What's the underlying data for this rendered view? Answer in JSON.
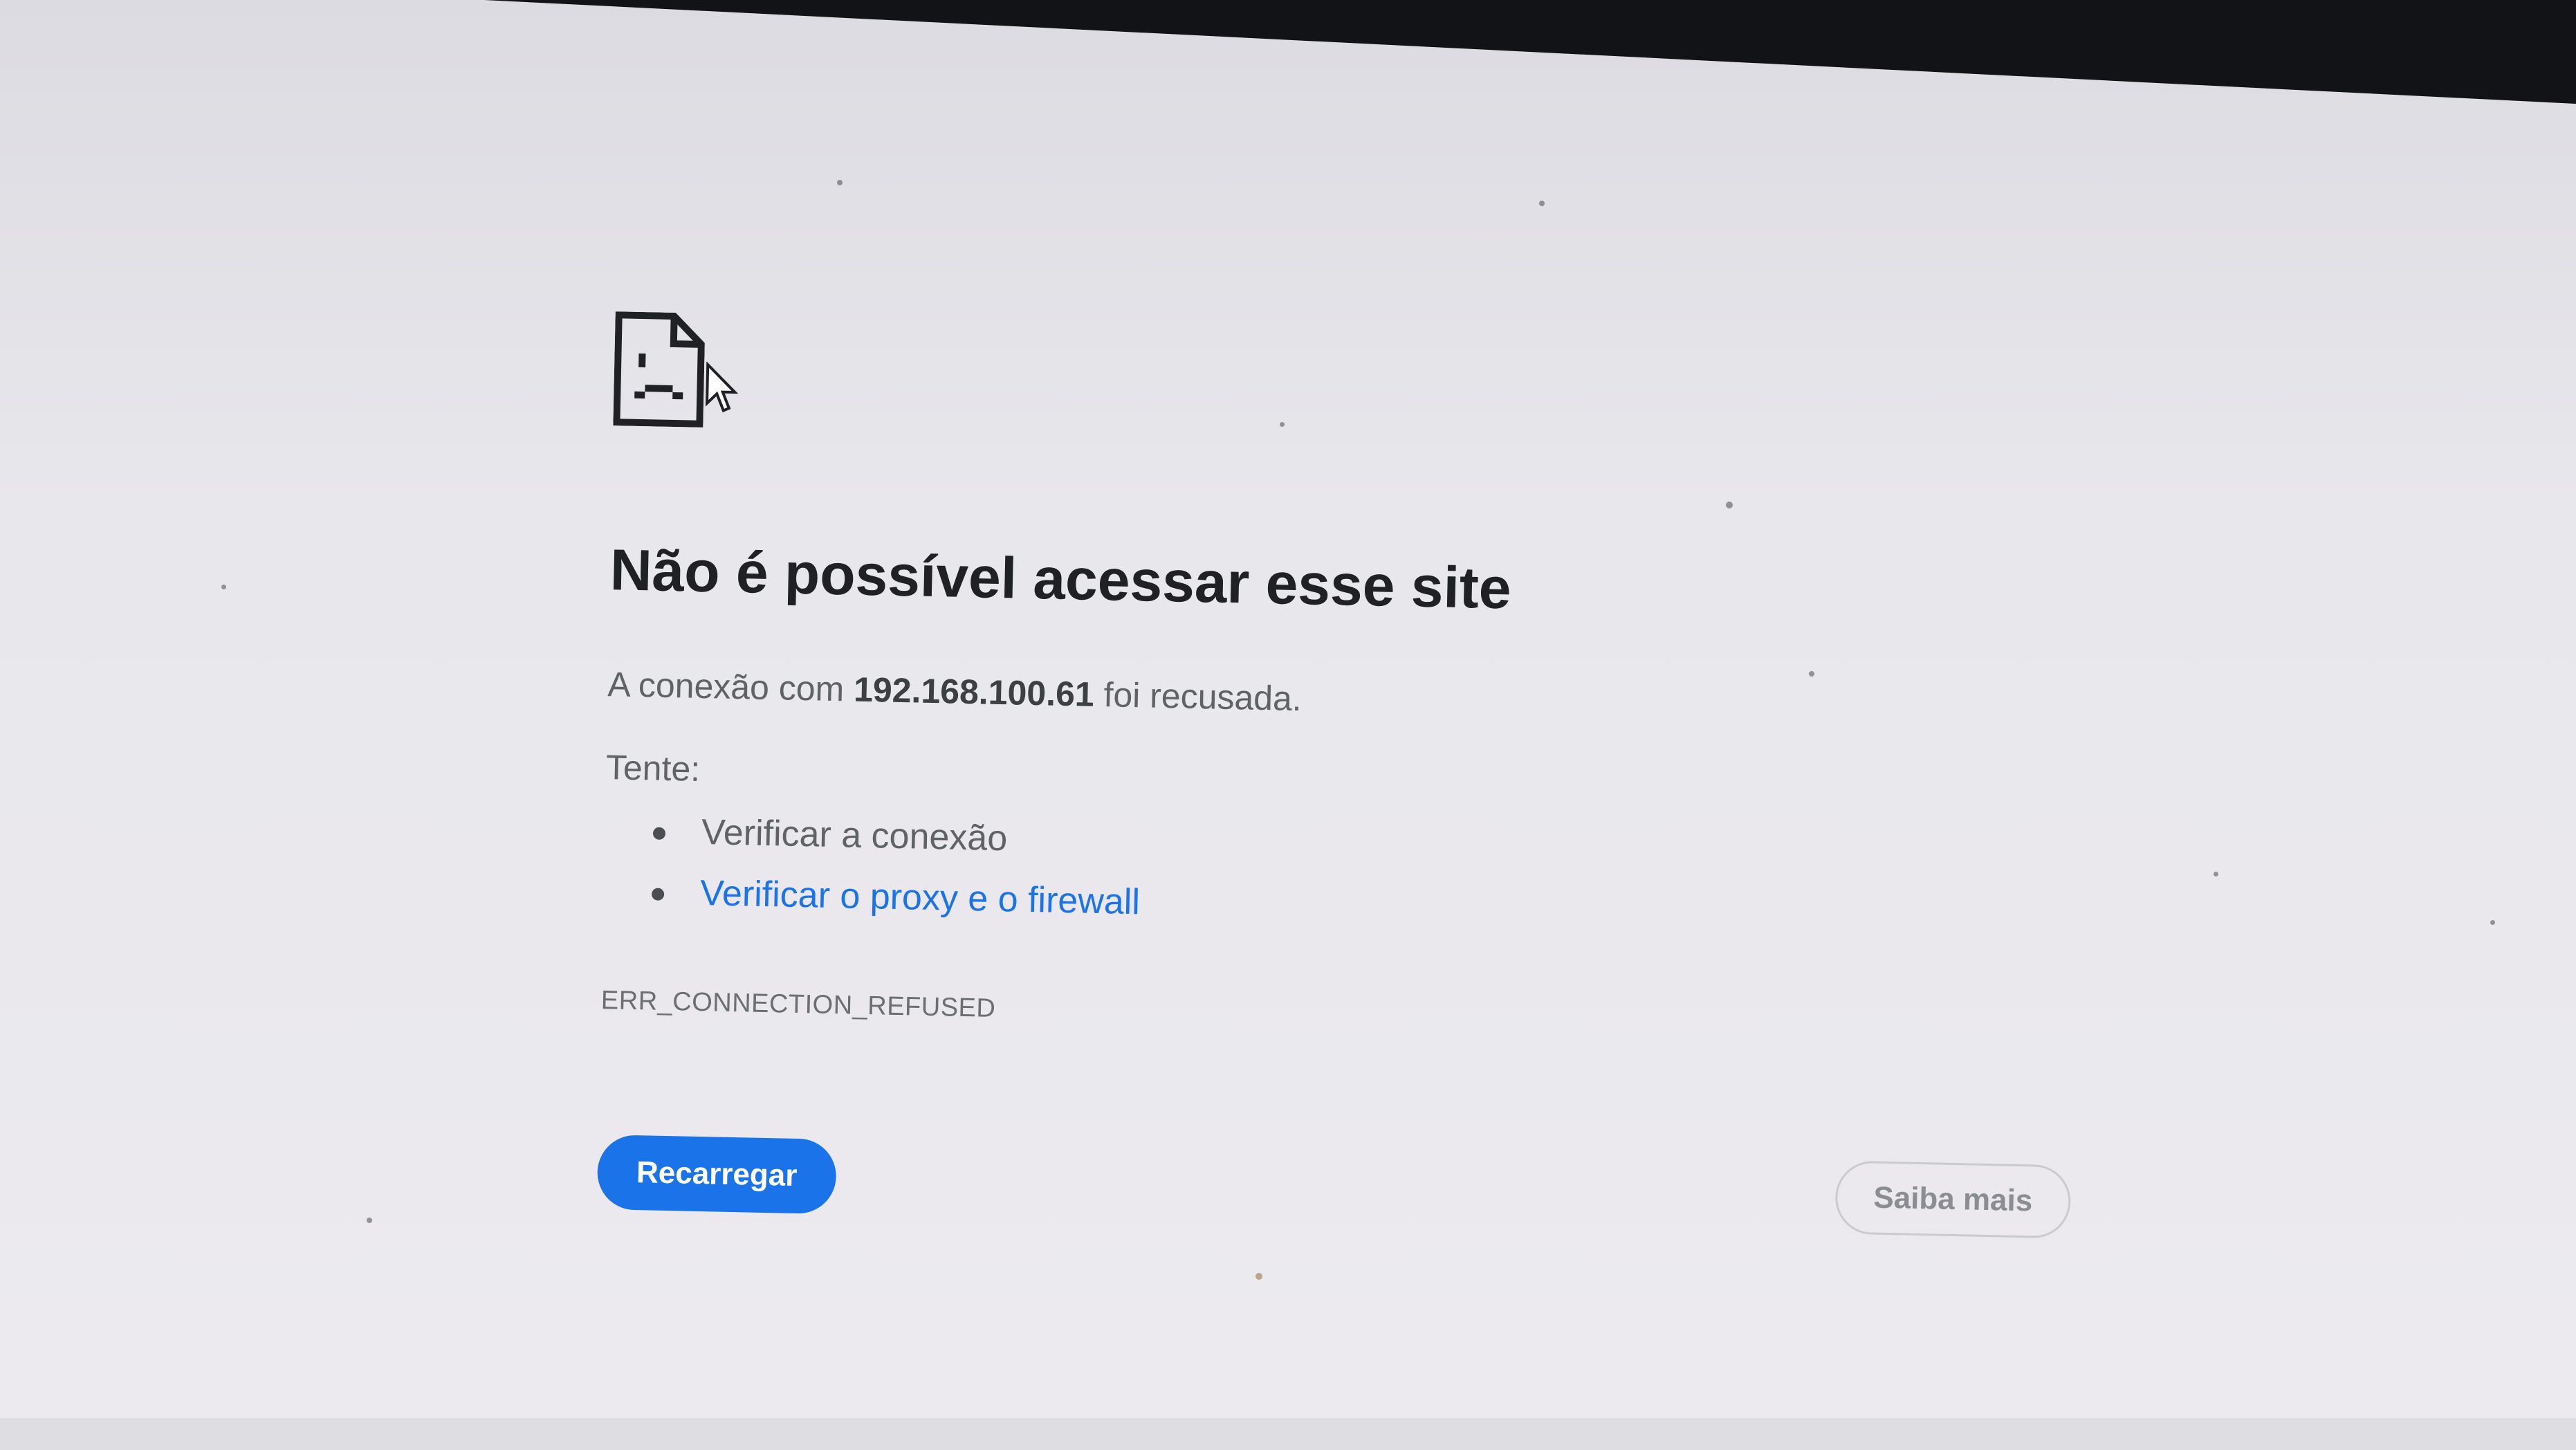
{
  "error_page": {
    "title": "Não é possível acessar esse site",
    "description_prefix": "A conexão com ",
    "host": "192.168.100.61",
    "description_suffix": " foi recusada.",
    "try_label": "Tente:",
    "suggestions": [
      {
        "label": "Verificar a conexão",
        "is_link": false
      },
      {
        "label": "Verificar o proxy e o firewall",
        "is_link": true
      }
    ],
    "error_code": "ERR_CONNECTION_REFUSED",
    "reload_label": "Recarregar",
    "learn_more_label": "Saiba mais"
  },
  "colors": {
    "accent": "#1a73e8",
    "title_text": "#202124",
    "body_text": "#5f6368",
    "background": "#ebeaee"
  },
  "icons": [
    "sad-page-icon",
    "mouse-cursor-icon"
  ]
}
